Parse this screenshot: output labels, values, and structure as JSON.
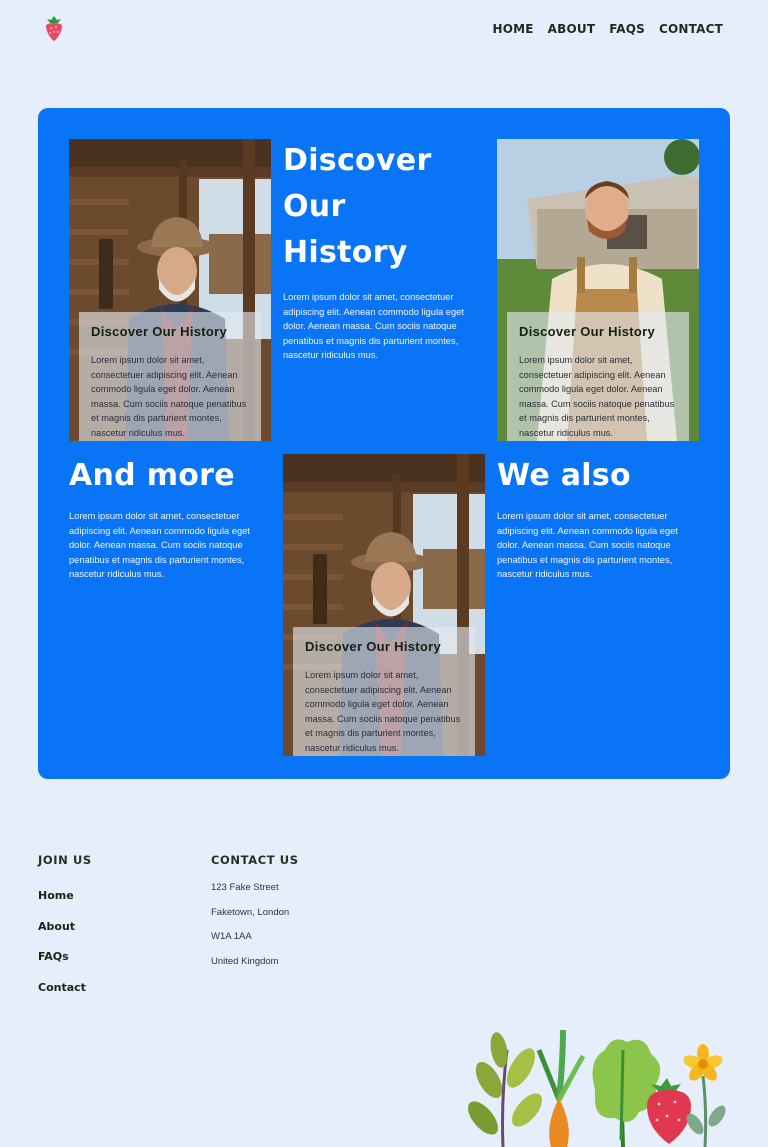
{
  "header": {
    "logo": "strawberry-logo",
    "nav": [
      "HOME",
      "ABOUT",
      "FAQS",
      "CONTACT"
    ]
  },
  "hero": {
    "main": {
      "title_line1": "Discover",
      "title_line2": "Our History",
      "body": "Lorem ipsum dolor sit amet, consectetuer adipiscing elit. Aenean commodo ligula eget dolor. Aenean massa. Cum sociis natoque penatibus et magnis dis parturient montes, nascetur ridiculus mus."
    },
    "more": {
      "title": "And more",
      "body": "Lorem ipsum dolor sit amet, consectetuer adipiscing elit. Aenean commodo ligula eget dolor. Aenean massa. Cum sociis natoque penatibus et magnis dis parturient montes, nascetur ridiculus mus."
    },
    "also": {
      "title": "We also",
      "body": "Lorem ipsum dolor sit amet, consectetuer adipiscing elit. Aenean commodo ligula eget dolor. Aenean massa. Cum sociis natoque penatibus et magnis dis parturient montes, nascetur ridiculus mus."
    },
    "cards": [
      {
        "title": "Discover Our History",
        "body": "Lorem ipsum dolor sit amet, consectetuer adipiscing elit. Aenean commodo ligula eget dolor. Aenean massa. Cum sociis natoque penatibus et magnis dis parturient montes, nascetur ridiculus mus."
      },
      {
        "title": "Discover Our History",
        "body": "Lorem ipsum dolor sit amet, consectetuer adipiscing elit. Aenean commodo ligula eget dolor. Aenean massa. Cum sociis natoque penatibus et magnis dis parturient montes, nascetur ridiculus mus."
      },
      {
        "title": "Discover Our History",
        "body": "Lorem ipsum dolor sit amet, consectetuer adipiscing elit. Aenean commodo ligula eget dolor. Aenean massa. Cum sociis natoque penatibus et magnis dis parturient montes, nascetur ridiculus mus."
      }
    ]
  },
  "footer": {
    "join_heading": "JOIN US",
    "links": [
      "Home",
      "About",
      "FAQs",
      "Contact"
    ],
    "contact_heading": "CONTACT US",
    "address": [
      "123 Fake Street",
      "Faketown, London",
      "W1A 1AA",
      "United Kingdom"
    ],
    "illustration": "vegetables-illustration"
  },
  "colors": {
    "page_bg": "#e6eefc",
    "panel": "#0a74f7",
    "heading_dark": "#1b2c1a"
  }
}
